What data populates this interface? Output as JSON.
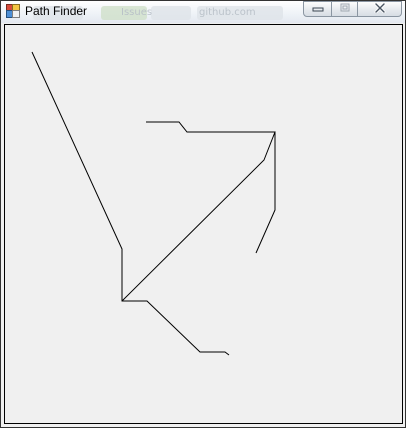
{
  "window": {
    "title": "Path Finder",
    "icon": "application-icon",
    "controls": [
      "minimize-icon",
      "maximize-icon",
      "close-icon"
    ]
  },
  "background_ghost_text": [
    "Issues",
    "github.com"
  ],
  "canvas": {
    "background_color": "#f0f0f0",
    "stroke_color": "#000000"
  }
}
